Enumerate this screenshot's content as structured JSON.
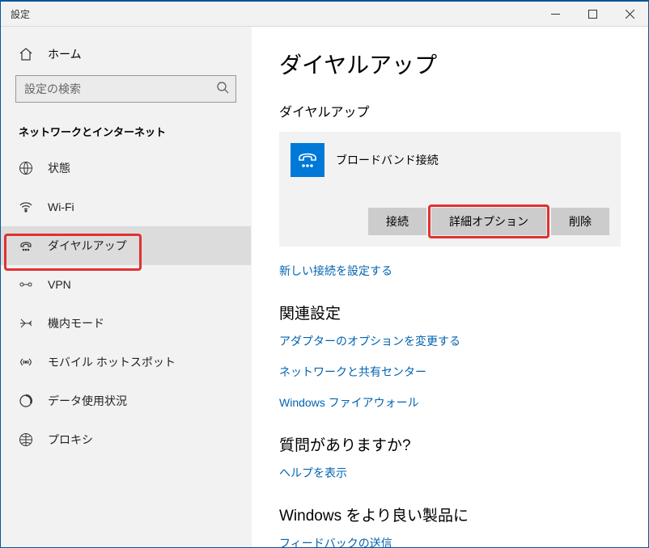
{
  "window": {
    "title": "設定"
  },
  "sidebar": {
    "home": "ホーム",
    "search_placeholder": "設定の検索",
    "category": "ネットワークとインターネット",
    "items": [
      {
        "label": "状態"
      },
      {
        "label": "Wi-Fi"
      },
      {
        "label": "ダイヤルアップ"
      },
      {
        "label": "VPN"
      },
      {
        "label": "機内モード"
      },
      {
        "label": "モバイル ホットスポット"
      },
      {
        "label": "データ使用状況"
      },
      {
        "label": "プロキシ"
      }
    ]
  },
  "main": {
    "title": "ダイヤルアップ",
    "subtitle": "ダイヤルアップ",
    "connection": {
      "name": "ブロードバンド接続",
      "connect": "接続",
      "advanced": "詳細オプション",
      "delete": "削除"
    },
    "new_connection": "新しい接続を設定する",
    "related": {
      "title": "関連設定",
      "adapter": "アダプターのオプションを変更する",
      "sharing": "ネットワークと共有センター",
      "firewall": "Windows ファイアウォール"
    },
    "help": {
      "title": "質問がありますか?",
      "show": "ヘルプを表示"
    },
    "feedback": {
      "title": "Windows をより良い製品に",
      "send": "フィードバックの送信"
    }
  }
}
